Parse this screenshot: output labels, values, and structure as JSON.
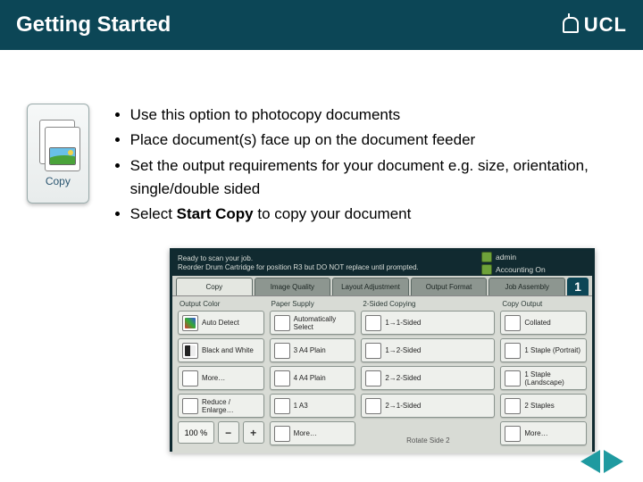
{
  "header": {
    "title": "Getting Started",
    "logo_text": "UCL"
  },
  "tile": {
    "label": "Copy"
  },
  "instructions": {
    "items": [
      "Use this option to photocopy documents",
      "Place document(s) face up on the document feeder",
      "Set the output requirements for your document  e.g. size, orientation, single/double sided"
    ],
    "final_prefix": "Select ",
    "final_bold": "Start Copy",
    "final_suffix": " to copy your document"
  },
  "panel": {
    "status_line1": "Ready to scan your job.",
    "status_line2": "Reorder Drum Cartridge for position R3 but DO NOT replace until prompted.",
    "user": "admin",
    "acct": "Accounting On",
    "tabs": [
      "Copy",
      "Image Quality",
      "Layout Adjustment",
      "Output Format",
      "Job Assembly"
    ],
    "qty": "1",
    "columns": {
      "output_color": {
        "heading": "Output Color",
        "opts": [
          "Auto Detect",
          "Black and White",
          "More…"
        ],
        "reduce_label": "Reduce / Enlarge…",
        "percent": "100 %"
      },
      "paper_supply": {
        "heading": "Paper Supply",
        "opts": [
          "Automatically Select",
          "3  A4 Plain",
          "4  A4 Plain",
          "1  A3",
          "More…"
        ]
      },
      "two_sided": {
        "heading": "2-Sided Copying",
        "opts": [
          "1→1-Sided",
          "1→2-Sided",
          "2→2-Sided",
          "2→1-Sided"
        ],
        "rotate": "Rotate Side 2"
      },
      "copy_output": {
        "heading": "Copy Output",
        "opts": [
          "Collated",
          "1 Staple (Portrait)",
          "1 Staple (Landscape)",
          "2 Staples",
          "More…"
        ]
      }
    }
  }
}
